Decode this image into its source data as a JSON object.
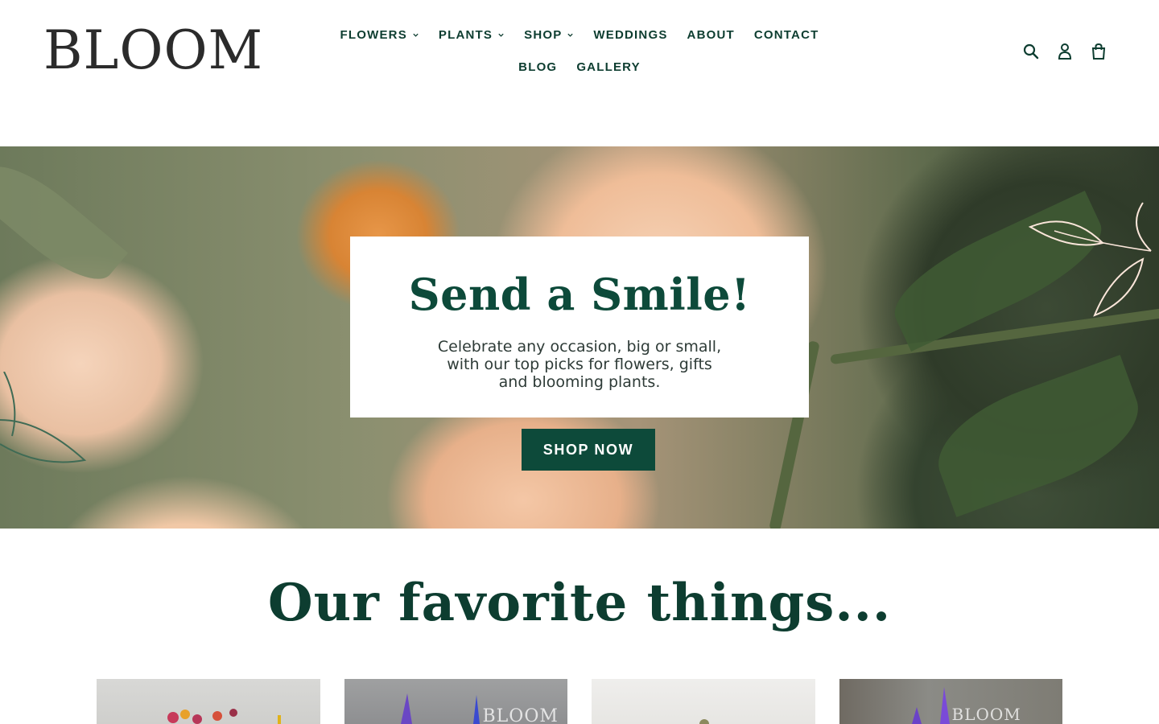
{
  "brand": {
    "logo_text": "BLOOM"
  },
  "nav": {
    "items": [
      {
        "label": "FLOWERS",
        "has_dropdown": true
      },
      {
        "label": "PLANTS",
        "has_dropdown": true
      },
      {
        "label": "SHOP",
        "has_dropdown": true
      },
      {
        "label": "WEDDINGS",
        "has_dropdown": false
      },
      {
        "label": "ABOUT",
        "has_dropdown": false
      },
      {
        "label": "CONTACT",
        "has_dropdown": false
      },
      {
        "label": "BLOG",
        "has_dropdown": false
      },
      {
        "label": "GALLERY",
        "has_dropdown": false
      }
    ]
  },
  "header_icons": [
    "search-icon",
    "account-icon",
    "cart-icon"
  ],
  "hero": {
    "title": "Send a Smile!",
    "text": "Celebrate any occasion, big or small, with our top picks for flowers, gifts and blooming plants.",
    "cta_label": "SHOP NOW"
  },
  "featured": {
    "title": "Our favorite things...",
    "products": [
      {
        "watermark": ""
      },
      {
        "watermark": "BLOOM"
      },
      {
        "watermark": ""
      },
      {
        "watermark": "BLOOM"
      }
    ]
  },
  "colors": {
    "primary": "#0d4a3a",
    "nav_text": "#0d3d30",
    "logo": "#2b2b2b",
    "background": "#ffffff"
  }
}
